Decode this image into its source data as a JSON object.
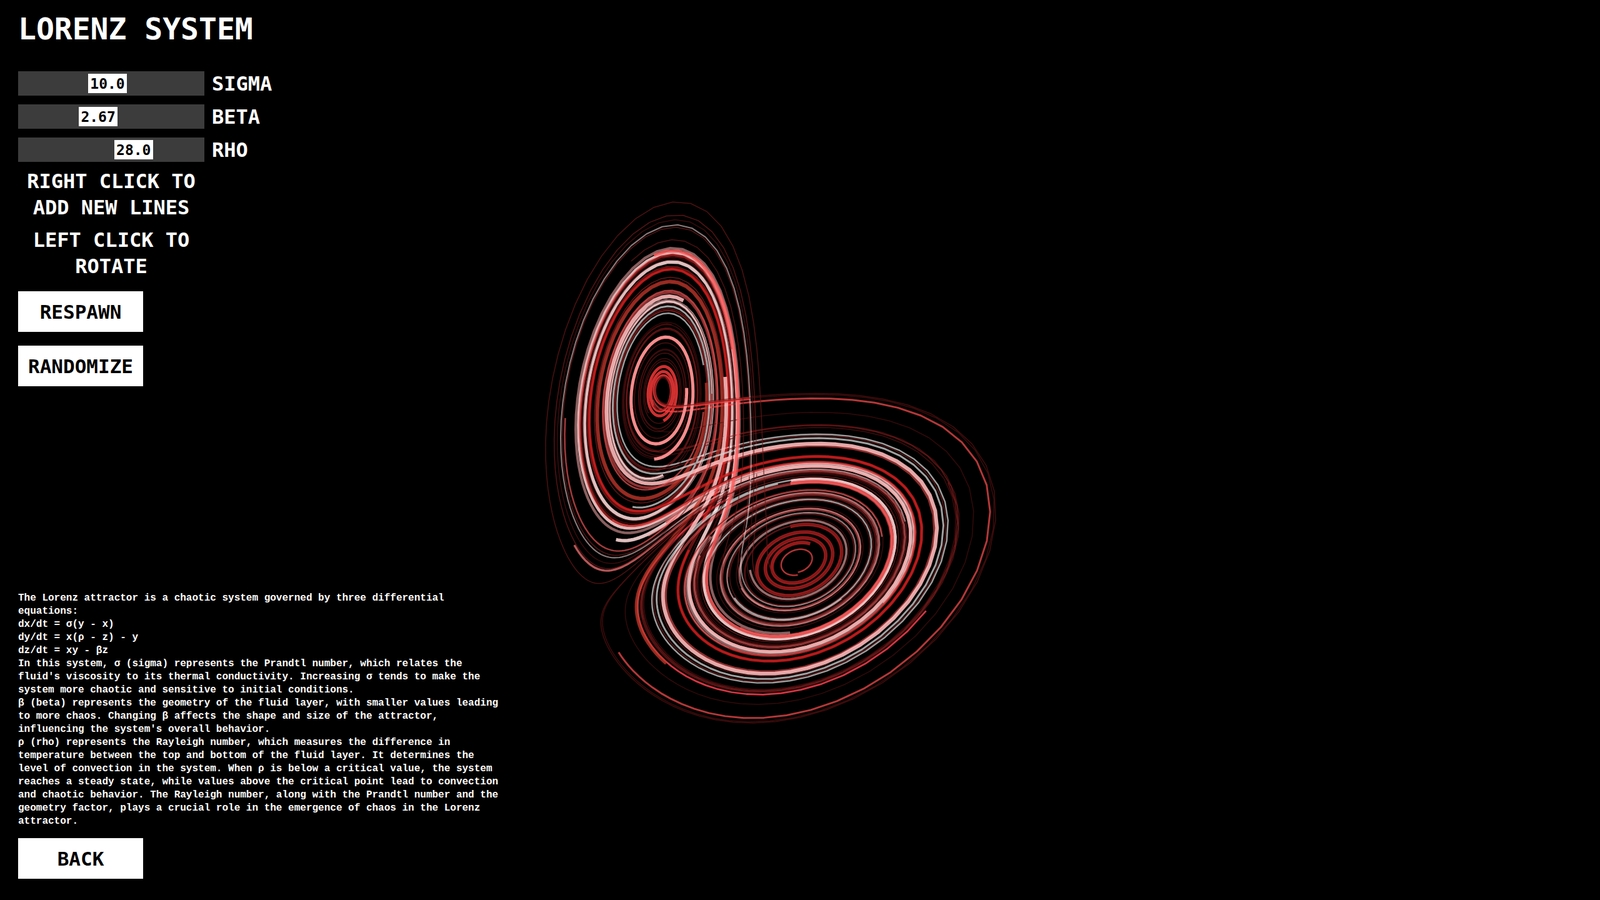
{
  "title": "LORENZ SYSTEM",
  "sliders": [
    {
      "label": "SIGMA",
      "value": "10.0",
      "level": 0.48
    },
    {
      "label": "BETA",
      "value": "2.67",
      "level": 0.43
    },
    {
      "label": "RHO",
      "value": "28.0",
      "level": 0.62
    }
  ],
  "hints": [
    "RIGHT CLICK TO ADD NEW LINES",
    "LEFT CLICK TO ROTATE"
  ],
  "buttons": [
    "RESPAWN",
    "RANDOMIZE"
  ],
  "description": [
    "The Lorenz attractor is a chaotic system governed by three differential equations:",
    "dx/dt = σ(y - x)",
    "dy/dt = x(ρ - z) - y",
    "dz/dt = xy - βz",
    "In this system, σ (sigma) represents the Prandtl number, which relates the fluid's viscosity to its thermal conductivity. Increasing σ tends to make the system more chaotic and sensitive to initial conditions.",
    "β (beta) represents the geometry of the fluid layer, with smaller values leading to more chaos. Changing β affects the shape and size of the attractor, influencing the system's overall behavior.",
    "ρ (rho) represents the Rayleigh number, which measures the difference in temperature between the top and bottom of the fluid layer. It determines the level of convection in the system. When ρ is below a critical value, the system reaches a steady state, while values above the critical point lead to convection and chaotic behavior. The Rayleigh number, along with the Prandtl number and the geometry factor, plays a crucial role in the emergence of chaos in the Lorenz attractor."
  ],
  "back_button": "BACK",
  "attractor": {
    "lines": [
      {
        "color": "#ff2a2a"
      },
      {
        "color": "#ff7a7a"
      },
      {
        "color": "#f6b3b3"
      },
      {
        "color": "#6a1616"
      },
      {
        "color": "#ffd9d9"
      },
      {
        "color": "#e63946"
      },
      {
        "color": "#b22222"
      },
      {
        "color": "#5a1010"
      },
      {
        "color": "#ff9090"
      },
      {
        "color": "#ffffff"
      },
      {
        "color": "#d94a4a"
      },
      {
        "color": "#7a1c1c"
      },
      {
        "color": "#ff4d4d"
      },
      {
        "color": "#f2c4c4"
      },
      {
        "color": "#c0392b"
      },
      {
        "color": "#4a0e0e"
      },
      {
        "color": "#ff6b6b"
      },
      {
        "color": "#e8a0a0"
      },
      {
        "color": "#ff1f1f"
      },
      {
        "color": "#8b2020"
      },
      {
        "color": "#ffbcbc"
      },
      {
        "color": "#ee5555"
      },
      {
        "color": "#d0d0d0"
      },
      {
        "color": "#5e1212"
      },
      {
        "color": "#ff3b3b"
      },
      {
        "color": "#fa8e8e"
      },
      {
        "color": "#c82828"
      },
      {
        "color": "#6e1818"
      },
      {
        "color": "#ffe0e0"
      },
      {
        "color": "#e04040"
      },
      {
        "color": "#ff5c5c"
      },
      {
        "color": "#561010"
      }
    ]
  }
}
